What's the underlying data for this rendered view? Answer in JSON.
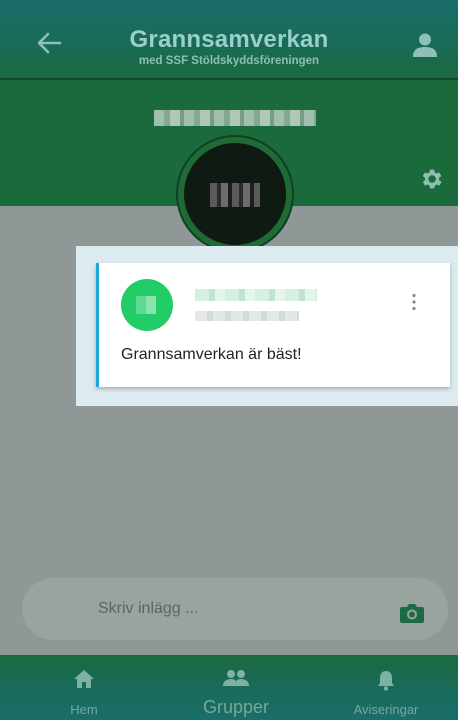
{
  "header": {
    "title": "Grannsamverkan",
    "subtitle": "med SSF Stöldskyddsföreningen",
    "back_icon": "arrow-left-icon",
    "profile_icon": "person-icon"
  },
  "banner": {
    "settings_icon": "gear-icon"
  },
  "post": {
    "text": "Grannsamverkan är bäst!",
    "menu_icon": "more-vertical-icon"
  },
  "composer": {
    "placeholder": "Skriv inlägg ...",
    "value": "",
    "camera_icon": "camera-icon"
  },
  "nav": {
    "items": [
      {
        "label": "Hem",
        "icon": "home-icon"
      },
      {
        "label": "Grupper",
        "icon": "group-icon"
      },
      {
        "label": "Aviseringar",
        "icon": "bell-icon"
      }
    ]
  },
  "colors": {
    "header": "#1a6a3f",
    "accent_green": "#22cc66",
    "card_border": "#1ea7dd",
    "overlay": "#8f9896"
  }
}
